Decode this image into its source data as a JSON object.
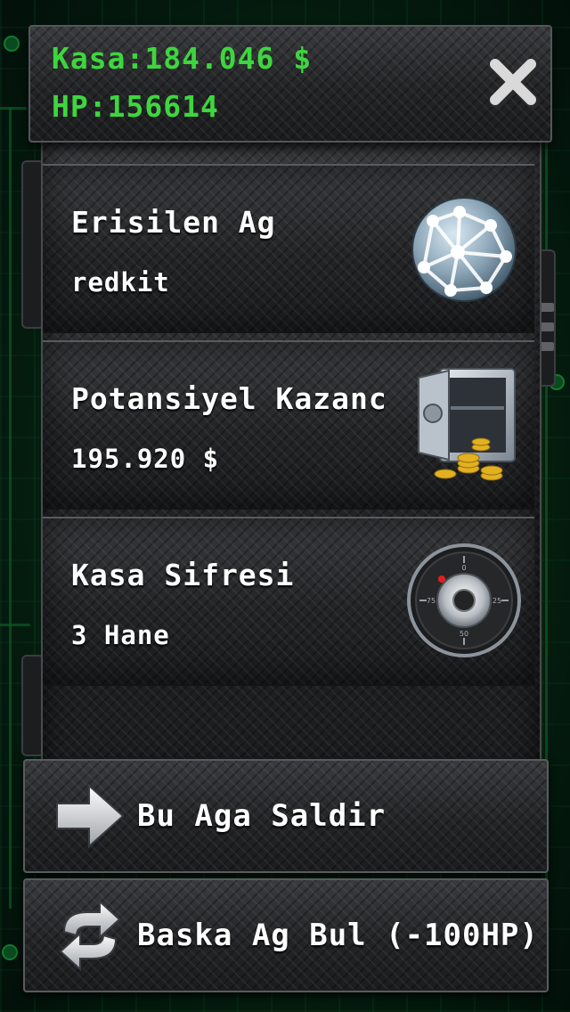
{
  "header": {
    "kasa_label": "Kasa:184.046 $",
    "hp_label": "HP:156614",
    "close_icon": "close-x-icon"
  },
  "cards": [
    {
      "title": "Erisilen Ag",
      "value": "redkit",
      "icon": "network-globe-icon"
    },
    {
      "title": "Potansiyel Kazanc",
      "value": "195.920 $",
      "icon": "open-safe-with-coins-icon"
    },
    {
      "title": "Kasa Sifresi",
      "value": "3 Hane",
      "icon": "combination-dial-icon"
    }
  ],
  "dial_labels": {
    "top": "0",
    "right": "25",
    "bottom": "50",
    "left": "75"
  },
  "actions": {
    "attack_label": "Bu Aga Saldir",
    "attack_icon": "arrow-right-icon",
    "find_label": "Baska Ag Bul (-100HP)",
    "find_icon": "refresh-arrows-icon"
  },
  "colors": {
    "hud_text": "#3ed63e",
    "label_text": "#ffffff",
    "plate": "#2a2b2d",
    "background": "#052010"
  }
}
